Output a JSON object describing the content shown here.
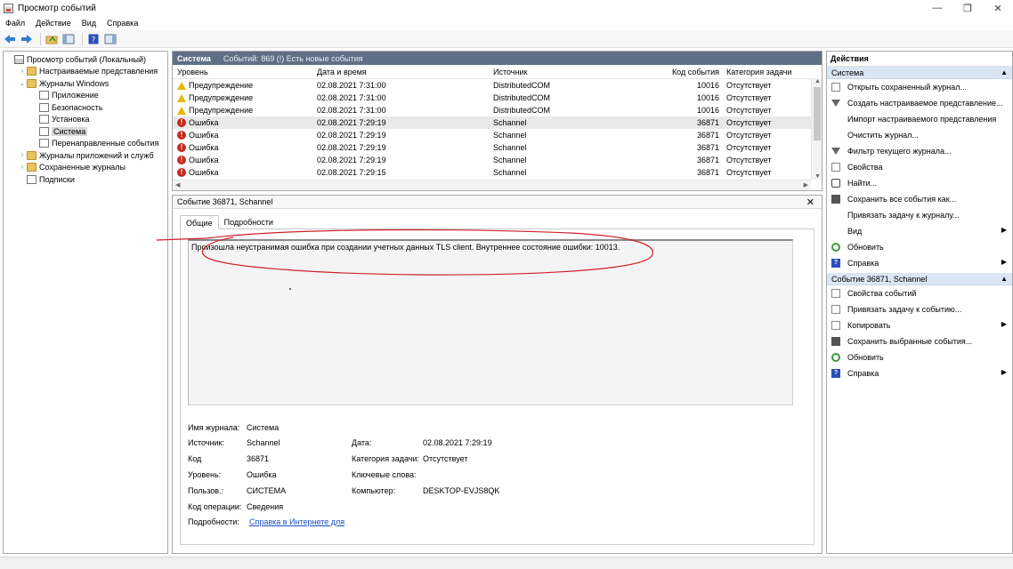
{
  "window": {
    "title": "Просмотр событий",
    "min": "—",
    "restore": "❐",
    "close": "✕"
  },
  "menu": [
    "Файл",
    "Действие",
    "Вид",
    "Справка"
  ],
  "tree": {
    "items": [
      {
        "label": "Просмотр событий (Локальный)",
        "indent": 0,
        "tw": "",
        "icon": "root"
      },
      {
        "label": "Настраиваемые представления",
        "indent": 1,
        "tw": "›",
        "icon": "folder"
      },
      {
        "label": "Журналы Windows",
        "indent": 1,
        "tw": "⌄",
        "icon": "folder"
      },
      {
        "label": "Приложение",
        "indent": 2,
        "tw": "",
        "icon": "log"
      },
      {
        "label": "Безопасность",
        "indent": 2,
        "tw": "",
        "icon": "log"
      },
      {
        "label": "Установка",
        "indent": 2,
        "tw": "",
        "icon": "log"
      },
      {
        "label": "Система",
        "indent": 2,
        "tw": "",
        "icon": "log",
        "selected": true
      },
      {
        "label": "Перенаправленные события",
        "indent": 2,
        "tw": "",
        "icon": "log"
      },
      {
        "label": "Журналы приложений и служб",
        "indent": 1,
        "tw": "›",
        "icon": "folder"
      },
      {
        "label": "Сохраненные журналы",
        "indent": 1,
        "tw": "›",
        "icon": "folder"
      },
      {
        "label": "Подписки",
        "indent": 1,
        "tw": "",
        "icon": "log"
      }
    ]
  },
  "events": {
    "header_name": "Система",
    "header_info": "Событий: 869 (!) Есть новые события",
    "columns": [
      "Уровень",
      "Дата и время",
      "Источник",
      "Код события",
      "Категория задачи"
    ],
    "rows": [
      {
        "level": "Предупреждение",
        "type": "warn",
        "date": "02.08.2021 7:31:00",
        "source": "DistributedCOM",
        "code": "10016",
        "category": "Отсутствует"
      },
      {
        "level": "Предупреждение",
        "type": "warn",
        "date": "02.08.2021 7:31:00",
        "source": "DistributedCOM",
        "code": "10016",
        "category": "Отсутствует"
      },
      {
        "level": "Предупреждение",
        "type": "warn",
        "date": "02.08.2021 7:31:00",
        "source": "DistributedCOM",
        "code": "10016",
        "category": "Отсутствует"
      },
      {
        "level": "Ошибка",
        "type": "err",
        "date": "02.08.2021 7:29:19",
        "source": "Schannel",
        "code": "36871",
        "category": "Отсутствует",
        "selected": true
      },
      {
        "level": "Ошибка",
        "type": "err",
        "date": "02.08.2021 7:29:19",
        "source": "Schannel",
        "code": "36871",
        "category": "Отсутствует"
      },
      {
        "level": "Ошибка",
        "type": "err",
        "date": "02.08.2021 7:29:19",
        "source": "Schannel",
        "code": "36871",
        "category": "Отсутствует"
      },
      {
        "level": "Ошибка",
        "type": "err",
        "date": "02.08.2021 7:29:19",
        "source": "Schannel",
        "code": "36871",
        "category": "Отсутствует"
      },
      {
        "level": "Ошибка",
        "type": "err",
        "date": "02.08.2021 7:29:15",
        "source": "Schannel",
        "code": "36871",
        "category": "Отсутствует"
      }
    ]
  },
  "detail": {
    "title": "Событие 36871, Schannel",
    "close": "✕",
    "tabs": [
      "Общие",
      "Подробности"
    ],
    "message": "Произошла неустранимая ошибка при создании учетных данных TLS client. Внутреннее состояние ошибки: 10013.",
    "props": {
      "log_label": "Имя журнала:",
      "log_value": "Система",
      "source_label": "Источник:",
      "source_value": "Schannel",
      "date_label": "Дата:",
      "date_value": "02.08.2021 7:29:19",
      "code_label": "Код",
      "code_value": "36871",
      "category_label": "Категория задачи:",
      "category_value": "Отсутствует",
      "level_label": "Уровень:",
      "level_value": "Ошибка",
      "keywords_label": "Ключевые слова:",
      "user_label": "Пользов.:",
      "user_value": "СИСТЕМА",
      "computer_label": "Компьютер:",
      "computer_value": "DESKTOP-EVJS8QK",
      "opcode_label": "Код операции:",
      "opcode_value": "Сведения",
      "more_label": "Подробности:",
      "more_link": "Справка в Интернете для"
    }
  },
  "actions": {
    "title": "Действия",
    "section1": "Система",
    "items1": [
      {
        "label": "Открыть сохраненный журнал...",
        "icon": "log"
      },
      {
        "label": "Создать настраиваемое представление...",
        "icon": "filter"
      },
      {
        "label": "Импорт настраиваемого представления",
        "icon": "none"
      },
      {
        "label": "Очистить журнал...",
        "icon": "none"
      },
      {
        "label": "Фильтр текущего журнала...",
        "icon": "filter"
      },
      {
        "label": "Свойства",
        "icon": "log"
      },
      {
        "label": "Найти...",
        "icon": "find"
      },
      {
        "label": "Сохранить все события как...",
        "icon": "save"
      },
      {
        "label": "Привязать задачу к журналу...",
        "icon": "none"
      },
      {
        "label": "Вид",
        "icon": "none",
        "submenu": true
      },
      {
        "label": "Обновить",
        "icon": "refresh"
      },
      {
        "label": "Справка",
        "icon": "help",
        "submenu": true
      }
    ],
    "section2": "Событие 36871, Schannel",
    "items2": [
      {
        "label": "Свойства событий",
        "icon": "log"
      },
      {
        "label": "Привязать задачу к событию...",
        "icon": "log"
      },
      {
        "label": "Копировать",
        "icon": "log",
        "submenu": true
      },
      {
        "label": "Сохранить выбранные события...",
        "icon": "save"
      },
      {
        "label": "Обновить",
        "icon": "refresh"
      },
      {
        "label": "Справка",
        "icon": "help",
        "submenu": true
      }
    ]
  },
  "colors": {
    "annotation": "#d0202a",
    "header_bar": "#5f6f86",
    "action_section": "#dae6f3",
    "link": "#1a4ec8"
  }
}
